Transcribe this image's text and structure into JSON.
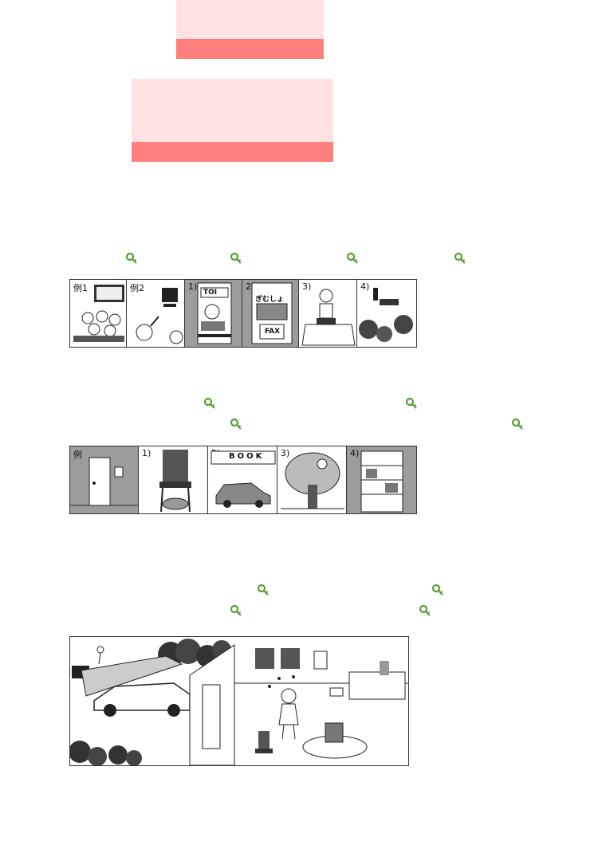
{
  "colors": {
    "box_fill": "#ffe3e3",
    "box_bar": "#ff7f7f",
    "key_icon": "#5a9e3a"
  },
  "icons": {
    "key": "key-icon"
  },
  "strip1": {
    "panels": [
      {
        "label": "例1"
      },
      {
        "label": "例2"
      },
      {
        "label": "1)"
      },
      {
        "label": "2)"
      },
      {
        "label": "3)"
      },
      {
        "label": "4)"
      }
    ],
    "signs": {
      "menu": "TOI",
      "shop": "ぎむしょ",
      "fax": "FAX"
    }
  },
  "strip2": {
    "panels": [
      {
        "label": "例"
      },
      {
        "label": "1)"
      },
      {
        "label": "2)"
      },
      {
        "label": "3)"
      },
      {
        "label": "4)"
      }
    ],
    "signs": {
      "book": "BOOK"
    }
  }
}
